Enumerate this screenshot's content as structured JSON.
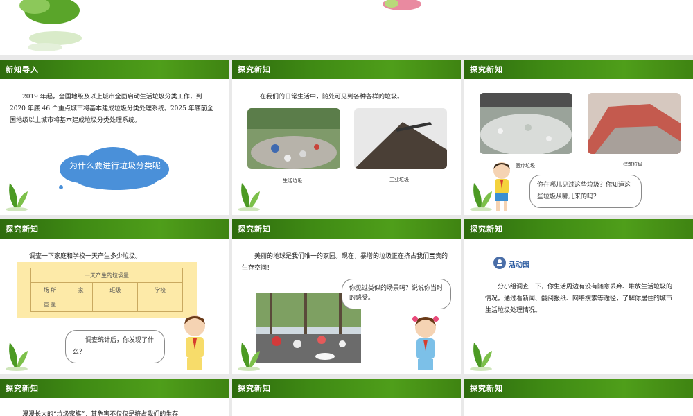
{
  "slides": {
    "s1": {
      "title": "新知导入",
      "para": "2019 年起，全国地级及以上城市全面启动生活垃圾分类工作，到 2020 年底 46 个重点城市将基本建成垃圾分类处理系统。2025 年底前全国地级以上城市将基本建成垃圾分类处理系统。",
      "cloud": "为什么要进行垃圾分类呢"
    },
    "s2": {
      "title": "探究新知",
      "para": "在我们的日常生活中，随处可见到各种各样的垃圾。",
      "cap1": "生活垃圾",
      "cap2": "工业垃圾"
    },
    "s3": {
      "title": "探究新知",
      "cap1": "医疗垃圾",
      "cap2": "建筑垃圾",
      "bubble": "你在哪儿见过这些垃圾？你知道这些垃圾从哪儿来的吗？"
    },
    "s4": {
      "title": "探究新知",
      "para": "调查一下家庭和学校一天产生多少垃圾。",
      "table_title": "一天产生的垃圾量",
      "row1": [
        "场 所",
        "家",
        "班级",
        "学校"
      ],
      "row2": [
        "重 量",
        "",
        "",
        ""
      ],
      "bubble": "调查统计后，你发现了什么？"
    },
    "s5": {
      "title": "探究新知",
      "para": "美丽的地球是我们唯一的家园。现在，暴增的垃圾正在挤占我们宝贵的生存空间！",
      "bubble": "你见过类似的场景吗？说说你当时的感受。"
    },
    "s6": {
      "title": "探究新知",
      "activity": "活动园",
      "para": "分小组调查一下，你生活周边有没有随意丢弃、堆放生活垃圾的情况。通过看新闻、翻阅报纸、网络搜索等途径，了解你居住的城市生活垃圾处理情况。"
    },
    "s7": {
      "title": "探究新知",
      "para": "漫漫长大的“垃圾家族”，其危害不仅仅是挤占我们的生存"
    },
    "s8": {
      "title": "探究新知"
    },
    "s9": {
      "title": "探究新知"
    }
  },
  "colors": {
    "bar": "#3f8a14",
    "cloud": "#4a90d9",
    "table_bg": "#fdeaa8",
    "page_bg": "#e9e9e9"
  }
}
